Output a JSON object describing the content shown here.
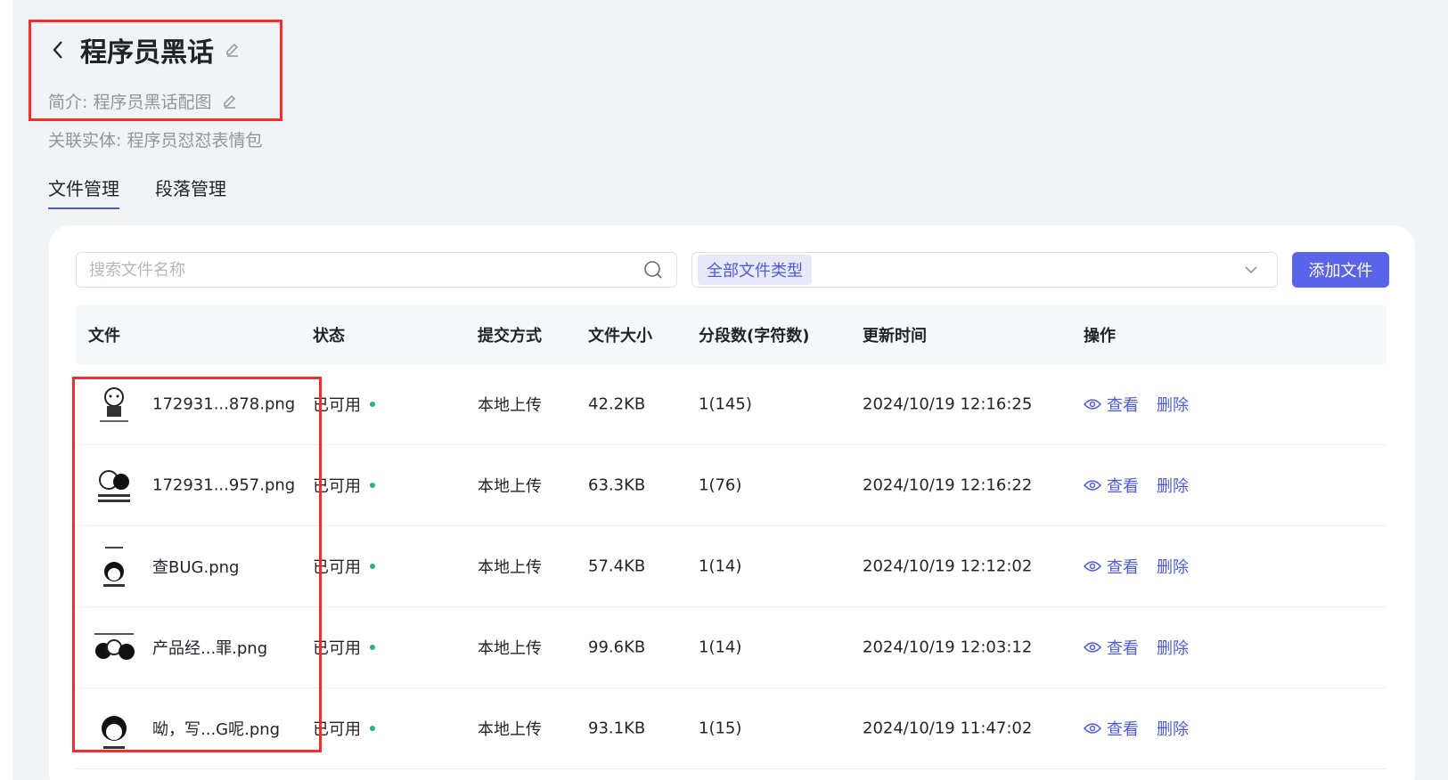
{
  "header": {
    "title": "程序员黑话",
    "intro": "简介: 程序员黑话配图",
    "entity": "关联实体: 程序员怼怼表情包"
  },
  "tabs": [
    {
      "label": "文件管理",
      "active": true
    },
    {
      "label": "段落管理",
      "active": false
    }
  ],
  "toolbar": {
    "search_placeholder": "搜索文件名称",
    "filter_value": "全部文件类型",
    "add_label": "添加文件"
  },
  "table": {
    "headers": [
      "文件",
      "状态",
      "提交方式",
      "文件大小",
      "分段数(字符数)",
      "更新时间",
      "操作"
    ],
    "rows": [
      {
        "name": "172931...878.png",
        "status": "已可用",
        "method": "本地上传",
        "size": "42.2KB",
        "segments": "1(145)",
        "updated": "2024/10/19 12:16:25"
      },
      {
        "name": "172931...957.png",
        "status": "已可用",
        "method": "本地上传",
        "size": "63.3KB",
        "segments": "1(76)",
        "updated": "2024/10/19 12:16:22"
      },
      {
        "name": "查BUG.png",
        "status": "已可用",
        "method": "本地上传",
        "size": "57.4KB",
        "segments": "1(14)",
        "updated": "2024/10/19 12:12:02"
      },
      {
        "name": "产品经...罪.png",
        "status": "已可用",
        "method": "本地上传",
        "size": "99.6KB",
        "segments": "1(14)",
        "updated": "2024/10/19 12:03:12"
      },
      {
        "name": "呦，写...G呢.png",
        "status": "已可用",
        "method": "本地上传",
        "size": "93.1KB",
        "segments": "1(15)",
        "updated": "2024/10/19 11:47:02"
      }
    ],
    "view_label": "查看",
    "delete_label": "删除"
  },
  "colors": {
    "accent": "#5b63e8",
    "status_ok": "#27b47a",
    "highlight": "#f0302f"
  }
}
